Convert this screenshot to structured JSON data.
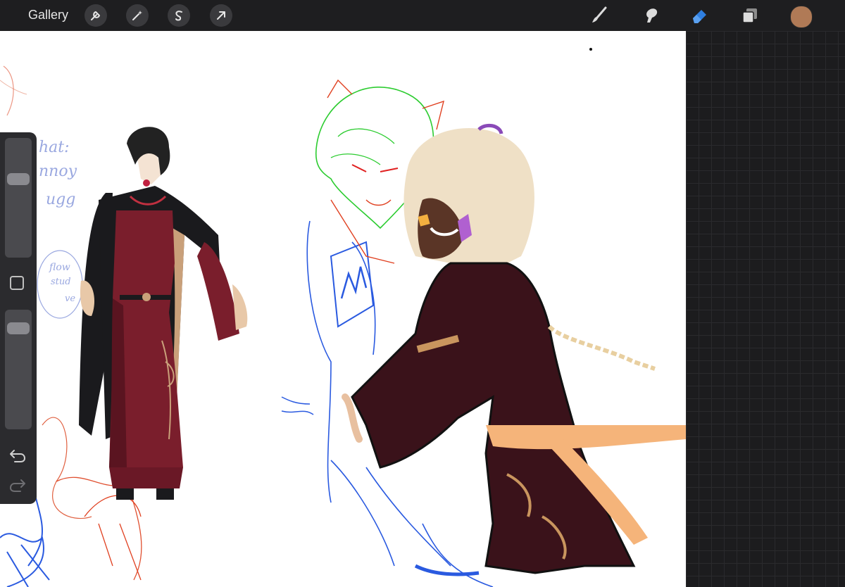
{
  "toolbar": {
    "gallery_label": "Gallery",
    "left_icons": [
      "wrench-icon",
      "magic-wand-icon",
      "selection-icon",
      "transform-arrow-icon"
    ],
    "right_icons": [
      "brush-icon",
      "smudge-icon",
      "eraser-icon",
      "layers-icon"
    ],
    "active_tool": "eraser",
    "active_tool_color": "#2f7fe0",
    "current_color": "#b07a56"
  },
  "sidebar": {
    "brush_size_level": 0.68,
    "opacity_level": 0.9,
    "icons": [
      "modify-square-icon",
      "undo-icon",
      "redo-icon"
    ]
  },
  "canvas_notes": {
    "line1": "hat:",
    "line2": "nnoy",
    "line3": "ugg",
    "bubble_line1": "flow",
    "bubble_line2": "stud",
    "bubble_line3": "ve"
  },
  "colors": {
    "robe": "#7a1e2c",
    "cloak": "#1a1a1d",
    "dark_robe": "#3a121a",
    "sash": "#f5b47a",
    "sketch_blue": "#2a5ae0",
    "sketch_green": "#2ccc30",
    "sketch_red": "#e04020"
  }
}
